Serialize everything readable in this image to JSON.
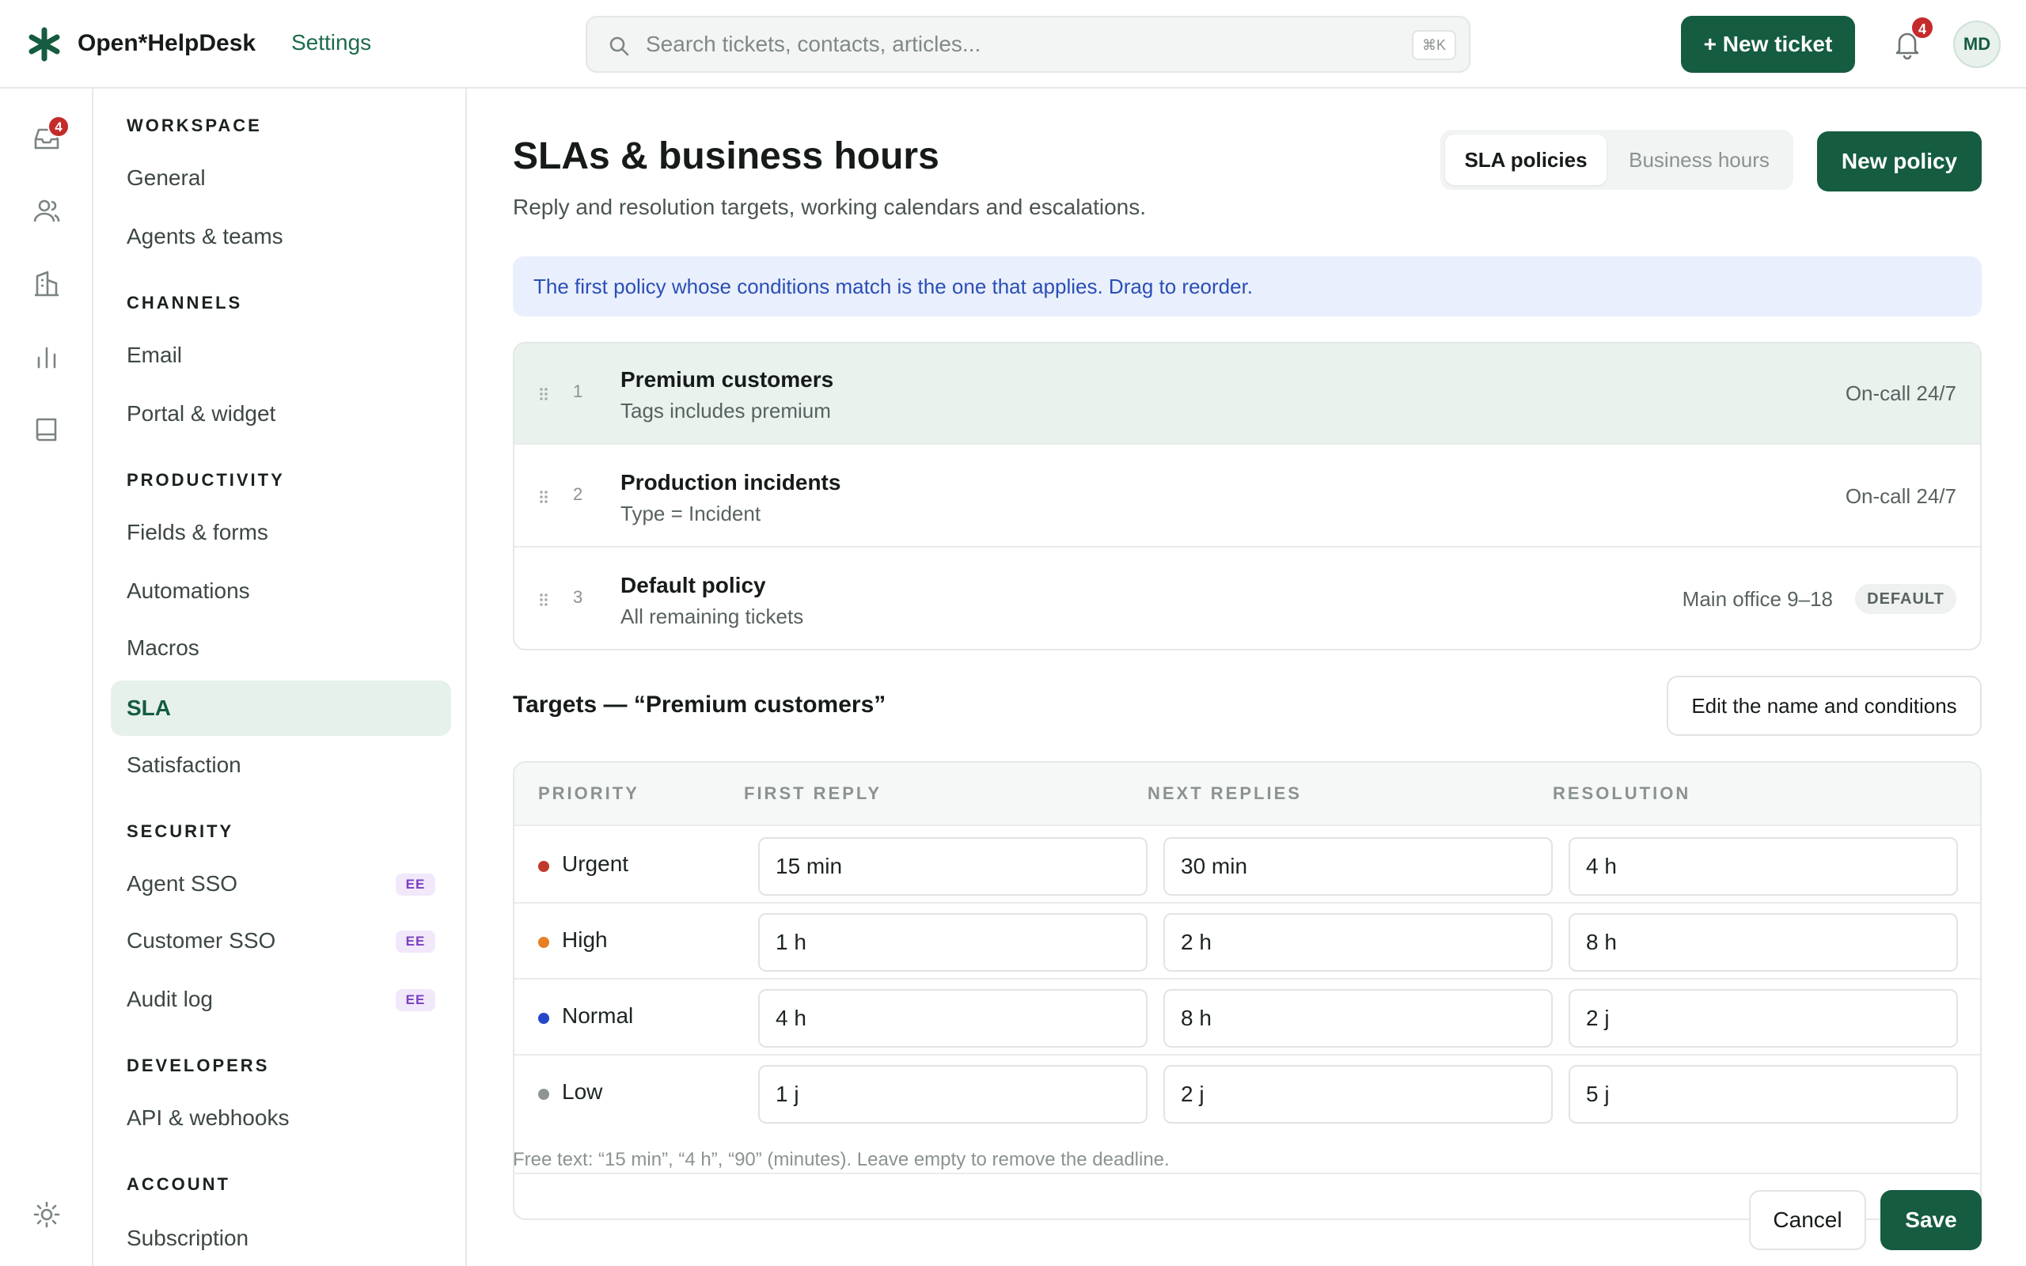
{
  "header": {
    "brand": "Open*HelpDesk",
    "section": "Settings",
    "search_placeholder": "Search tickets, contacts, articles...",
    "search_shortcut": "⌘K",
    "new_ticket_label": "+ New ticket",
    "notification_count": "4",
    "avatar_initials": "MD"
  },
  "rail": {
    "inbox_badge": "4",
    "icons": [
      "inbox-icon",
      "contacts-icon",
      "companies-icon",
      "reports-icon",
      "knowledge-base-icon",
      "settings-sun-icon"
    ]
  },
  "settings_nav": {
    "sections": {
      "workspace": "WORKSPACE",
      "channels": "CHANNELS",
      "productivity": "PRODUCTIVITY",
      "security": "SECURITY",
      "developers": "DEVELOPERS",
      "account": "ACCOUNT"
    },
    "items": {
      "general": "General",
      "agents_teams": "Agents & teams",
      "email": "Email",
      "portal_widget": "Portal & widget",
      "fields_forms": "Fields & forms",
      "automations": "Automations",
      "macros": "Macros",
      "sla": "SLA",
      "satisfaction": "Satisfaction",
      "agent_sso": "Agent SSO",
      "customer_sso": "Customer SSO",
      "audit_log": "Audit log",
      "api_webhooks": "API & webhooks",
      "subscription": "Subscription"
    },
    "ee_badge": "EE",
    "active": "SLA"
  },
  "main": {
    "title": "SLAs & business hours",
    "subtitle": "Reply and resolution targets, working calendars and escalations.",
    "tabs": {
      "sla_policies": "SLA policies",
      "business_hours": "Business hours"
    },
    "new_policy_label": "New policy",
    "info": "The first policy whose conditions match is the one that applies. Drag to reorder.",
    "policies": [
      {
        "num": "1",
        "name": "Premium customers",
        "condition": "Tags includes premium",
        "calendar": "On-call 24/7"
      },
      {
        "num": "2",
        "name": "Production incidents",
        "condition": "Type = Incident",
        "calendar": "On-call 24/7"
      },
      {
        "num": "3",
        "name": "Default policy",
        "condition": "All remaining tickets",
        "calendar": "Main office 9–18",
        "badge": "DEFAULT"
      }
    ],
    "targets_title": "Targets — “Premium customers”",
    "edit_label": "Edit the name and conditions",
    "columns": {
      "priority": "PRIORITY",
      "first_reply": "FIRST REPLY",
      "next_replies": "NEXT REPLIES",
      "resolution": "RESOLUTION"
    },
    "rows": [
      {
        "priority": "Urgent",
        "color": "#c0392b",
        "first_reply": "15 min",
        "next_replies": "30 min",
        "resolution": "4 h"
      },
      {
        "priority": "High",
        "color": "#e67e22",
        "first_reply": "1 h",
        "next_replies": "2 h",
        "resolution": "8 h"
      },
      {
        "priority": "Normal",
        "color": "#2447c9",
        "first_reply": "4 h",
        "next_replies": "8 h",
        "resolution": "2 j"
      },
      {
        "priority": "Low",
        "color": "#8e9592",
        "first_reply": "1 j",
        "next_replies": "2 j",
        "resolution": "5 j"
      }
    ],
    "hint": "Free text: “15 min”, “4 h”, “90” (minutes). Leave empty to remove the deadline.",
    "cancel_label": "Cancel",
    "save_label": "Save"
  },
  "colors": {
    "brand": "#155c40",
    "accent_bg": "#e6f1eb",
    "info_bg": "#e9effd",
    "info_text": "#2a4fb5"
  }
}
